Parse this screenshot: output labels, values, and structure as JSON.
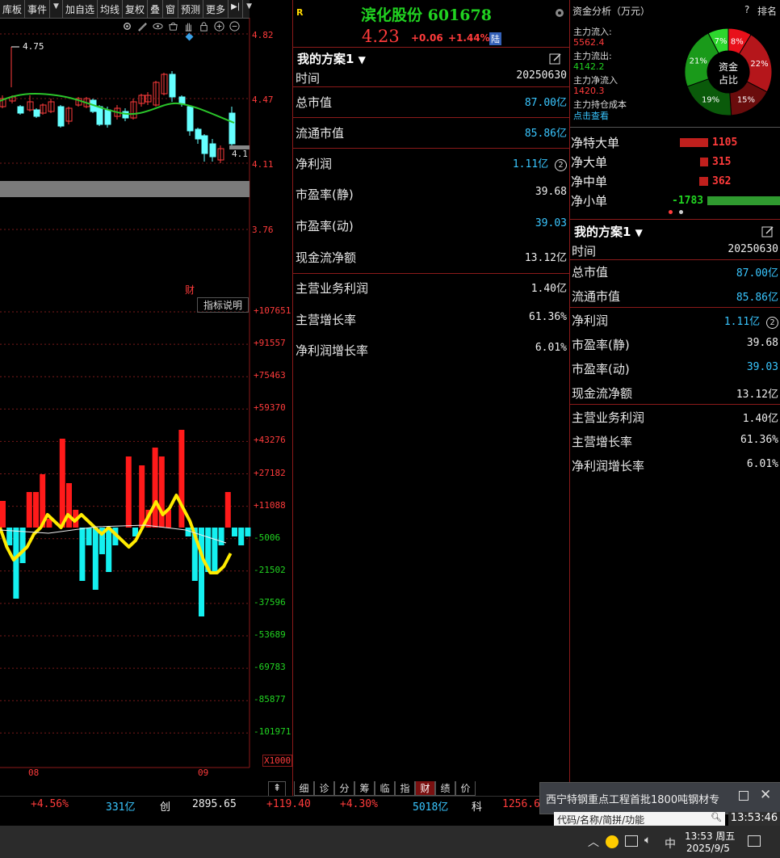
{
  "toolbar": {
    "items": [
      "库板",
      "事件",
      "加自选",
      "均线",
      "复权",
      "叠",
      "窗",
      "预测",
      "更多"
    ],
    "dropdown_glyph": "▼",
    "next_glyph": "▶|"
  },
  "kline": {
    "price_labels": [
      "4.82",
      "4.47",
      "4.11",
      "3.76"
    ],
    "high_mark": "4.75",
    "last_mark": "4.1",
    "caijing_marker": "财"
  },
  "volume": {
    "button": "指标说明",
    "axis_labels": [
      "+107651",
      "+91557",
      "+75463",
      "+59370",
      "+43276",
      "+27182",
      "+11088",
      "-5006",
      "-21502",
      "-37596",
      "-53689",
      "-69783",
      "-85877",
      "-101971"
    ],
    "multiplier": "X1000",
    "x_labels": [
      "08",
      "09"
    ],
    "bars": [
      3,
      -2,
      -8,
      -4,
      4,
      4,
      6,
      1,
      0,
      10,
      5,
      2,
      -6,
      -2,
      -7,
      -3,
      -5,
      -2,
      0,
      8,
      -1,
      7,
      2,
      9,
      8,
      2,
      0,
      11,
      -1,
      -6,
      -10,
      -5,
      -5,
      -2,
      4,
      -1,
      -2,
      -1
    ],
    "line": [
      0,
      -3,
      -5,
      -4,
      -3,
      -1,
      0,
      2,
      1,
      0,
      2,
      1,
      2,
      1,
      0,
      -1,
      0,
      -1,
      -2,
      -3,
      -2,
      0,
      2,
      4,
      2,
      3,
      5,
      3,
      1,
      -2,
      -5,
      -7,
      -7,
      -6,
      -4
    ]
  },
  "stock": {
    "logo": "R",
    "name": "滨化股份 601678",
    "price": "4.23",
    "change": "+0.06",
    "change_pct": "+1.44%",
    "exchange_badge": "陆"
  },
  "scheme": {
    "title": "我的方案1",
    "rows": [
      {
        "label": "时间",
        "value": "20250630",
        "color": "white"
      },
      {
        "label": "总市值",
        "value": "87.00亿",
        "color": "cyan"
      },
      {
        "label": "流通市值",
        "value": "85.86亿",
        "color": "cyan"
      },
      {
        "label": "净利润",
        "value": "1.11亿",
        "color": "cyan",
        "badge": "2"
      },
      {
        "label": "市盈率(静)",
        "value": "39.68",
        "color": "white"
      },
      {
        "label": "市盈率(动)",
        "value": "39.03",
        "color": "cyan"
      },
      {
        "label": "现金流净额",
        "value": "13.12亿",
        "color": "white"
      },
      {
        "label": "主营业务利润",
        "value": "1.40亿",
        "color": "white"
      },
      {
        "label": "主营增长率",
        "value": "61.36%",
        "color": "white"
      },
      {
        "label": "净利润增长率",
        "value": "6.01%",
        "color": "white"
      }
    ]
  },
  "fund_analysis": {
    "title": "资金分析（万元）",
    "help": "?",
    "rank": "排名",
    "inflow_label": "主力流入:",
    "inflow_value": "5562.4",
    "outflow_label": "主力流出:",
    "outflow_value": "4142.2",
    "net_label": "主力净流入",
    "net_value": "1420.3",
    "cost_label": "主力持仓成本",
    "cost_link": "点击查看",
    "pie_center": [
      "资金",
      "占比"
    ],
    "pie_labels": [
      "8%",
      "22%",
      "15%",
      "19%",
      "21%",
      "7%"
    ],
    "pie_values": [
      8,
      22,
      15,
      19,
      21,
      7
    ],
    "flows": [
      {
        "label": "净特大单",
        "value": "1105",
        "amount": 1105
      },
      {
        "label": "净大单",
        "value": "315",
        "amount": 315
      },
      {
        "label": "净中单",
        "value": "362",
        "amount": 362
      },
      {
        "label": "净小单",
        "value": "-1783",
        "amount": -1783
      }
    ]
  },
  "bottom_tabs": [
    "细",
    "诊",
    "分",
    "筹",
    "临",
    "指",
    "财",
    "绩",
    "价"
  ],
  "bottom_active": "财",
  "status": {
    "pct1": "+4.56%",
    "amount1": "331亿",
    "index2_name": "创",
    "index2_value": "2895.65",
    "index2_change": "+119.40",
    "index2_pct": "+4.30%",
    "amount2": "5018亿",
    "index3_name": "科",
    "index3_value": "1256.6"
  },
  "notification": {
    "text": "西宁特钢重点工程首批1800吨钢材专",
    "search_placeholder": "代码/名称/简拼/功能",
    "time": "13:53:46"
  },
  "taskbar": {
    "ime": "中",
    "clock_time": "13:53 周五",
    "clock_date": "2025/9/5"
  },
  "colors": {
    "up": "#ff3b3b",
    "down": "#21d321",
    "cyan": "#39c6ff",
    "border": "#8b1a1a"
  }
}
